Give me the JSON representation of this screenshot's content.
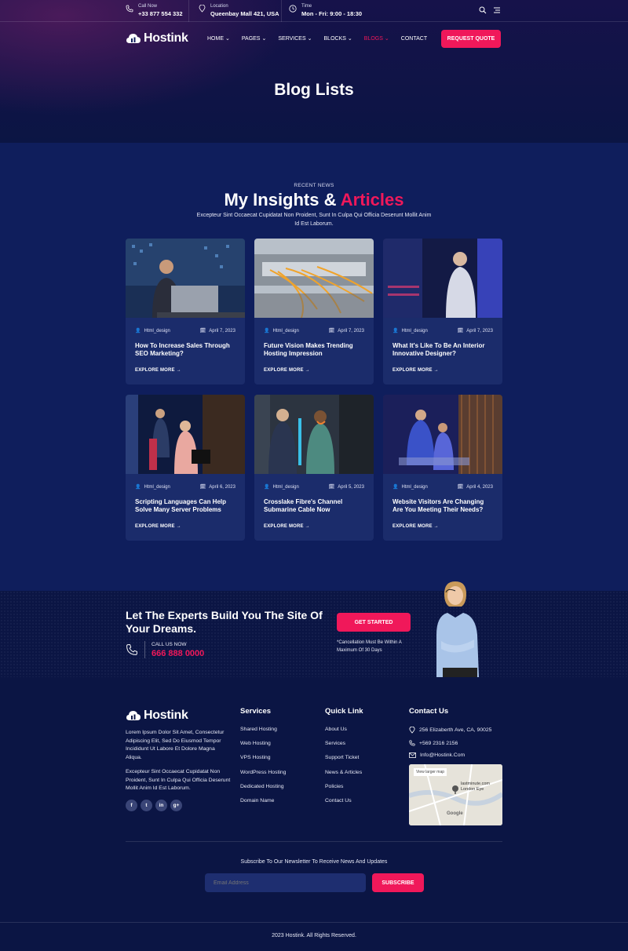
{
  "topbar": {
    "call_label": "Call Now",
    "call_value": "+33 877 554 332",
    "location_label": "Location",
    "location_value": "Queenbay Mall 421, USA",
    "time_label": "Time",
    "time_value": "Mon - Fri: 9:00 - 18:30"
  },
  "brand": {
    "name": "Hostink"
  },
  "nav": {
    "items": [
      "HOME",
      "PAGES",
      "SERVICES",
      "BLOCKS",
      "BLOGS",
      "CONTACT"
    ],
    "active": "BLOGS",
    "cta": "REQUEST QUOTE"
  },
  "hero": {
    "title": "Blog Lists"
  },
  "section": {
    "subtitle": "RECENT NEWS",
    "title_main": "My Insights & ",
    "title_accent": "Articles",
    "description": "Excepteur Sint Occaecat Cupidatat Non Proident, Sunt In Culpa Qui Officia Deserunt Mollit Anim Id Est Laborum."
  },
  "posts": [
    {
      "author": "Html_design",
      "date": "April 7, 2023",
      "title": "How To Increase Sales Through SEO Marketing?",
      "link": "EXPLORE MORE →"
    },
    {
      "author": "Html_design",
      "date": "April 7, 2023",
      "title": "Future Vision Makes Trending Hosting Impression",
      "link": "EXPLORE MORE →"
    },
    {
      "author": "Html_design",
      "date": "April 7, 2023",
      "title": "What It's Like To Be An Interior Innovative Designer?",
      "link": "EXPLORE MORE →"
    },
    {
      "author": "Html_design",
      "date": "April 6, 2023",
      "title": "Scripting Languages Can Help Solve Many Server Problems",
      "link": "EXPLORE MORE →"
    },
    {
      "author": "Html_design",
      "date": "April 5, 2023",
      "title": "Crosslake Fibre's Channel Submarine Cable Now",
      "link": "EXPLORE MORE →"
    },
    {
      "author": "Html_design",
      "date": "April 4, 2023",
      "title": "Website Visitors Are Changing Are You Meeting Their Needs?",
      "link": "EXPLORE MORE →"
    }
  ],
  "cta": {
    "title": "Let The Experts Build You The Site Of Your Dreams.",
    "call_label": "CALL US NOW",
    "phone": "666 888 0000",
    "button": "GET STARTED",
    "note": "*Cancellation Must Be Within A Maximum Of 30 Days"
  },
  "footer": {
    "about_1": "Lorem Ipsum Dolor Sit Amet, Consectetur Adipiscing Elit, Sed Do Eiusmod Tempor Incididunt Ut Labore Et Dolore Magna Aliqua.",
    "about_2": "Excepteur Sint Occaecat Cupidatat Non Proident, Sunt In Culpa Qui Officia Deserunt Mollit Anim Id Est Laborum.",
    "social": [
      "f",
      "t",
      "in",
      "g+"
    ],
    "services_title": "Services",
    "services": [
      "Shared Hosting",
      "Web Hosting",
      "VPS Hosting",
      "WordPress Hosting",
      "Dedicated Hosting",
      "Domain Name"
    ],
    "quick_title": "Quick Link",
    "quick": [
      "About Us",
      "Services",
      "Support Ticket",
      "News & Articles",
      "Policies",
      "Contact Us"
    ],
    "contact_title": "Contact Us",
    "address": "256 Elizaberth Ave, CA, 90025",
    "phone": "+569 2316 2156",
    "email": "Info@Hostink.Com",
    "map_link": "View larger map",
    "map_place": "lastminute.com London Eye",
    "map_google": "Google",
    "newsletter": "Subscribe To Our Newsletter To Receive News And Updates",
    "email_placeholder": "Email Address",
    "subscribe": "SUBSCRIBE",
    "copyright": "2023 Hostink. All Rights Reserved."
  },
  "colors": {
    "accent": "#f0185a",
    "bg": "#0b1544",
    "section": "#0f1e5c",
    "card": "#1b2c6b"
  }
}
